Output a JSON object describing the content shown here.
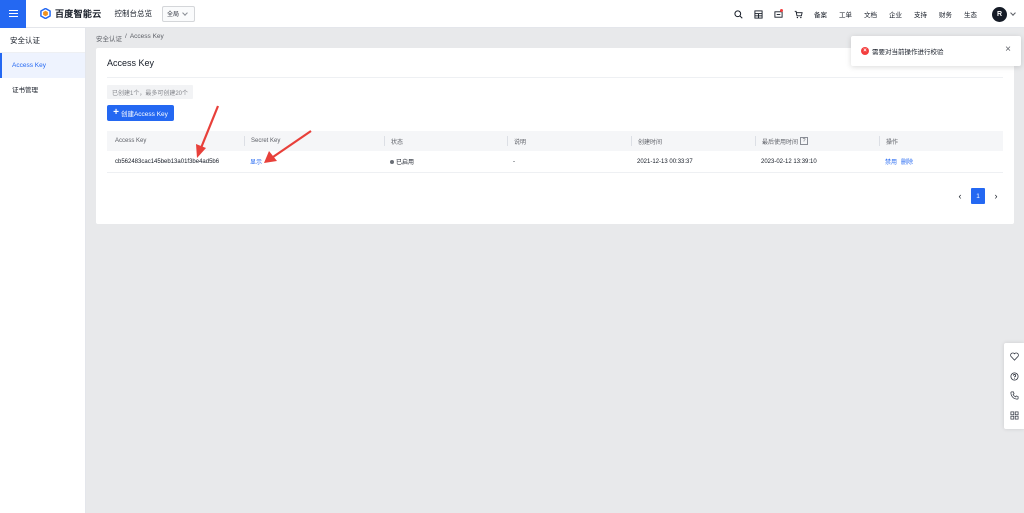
{
  "header": {
    "logo_text": "百度智能云",
    "console_label": "控制台总览",
    "region_label": "全局",
    "nav": [
      "备案",
      "工单",
      "文档",
      "企业",
      "支持",
      "财务",
      "生态"
    ],
    "avatar_initial": "R",
    "icons": [
      "search-icon",
      "grid-icon",
      "message-icon",
      "cart-icon"
    ]
  },
  "sidebar": {
    "title": "安全认证",
    "items": [
      {
        "label": "Access Key",
        "active": true
      },
      {
        "label": "证书管理",
        "active": false
      }
    ]
  },
  "breadcrumb": {
    "parent": "安全认证",
    "separator": "/",
    "current": "Access Key"
  },
  "card": {
    "title": "Access Key",
    "quota_text": "已创建1个，最多可创建20个",
    "create_button": "创建Access Key"
  },
  "table": {
    "columns": [
      "Access Key",
      "Secret Key",
      "状态",
      "说明",
      "创建时间",
      "最后使用时间",
      "操作"
    ],
    "help_mark": "?",
    "rows": [
      {
        "access_key": "cb562483cac145beb13a01f3be4ad5b6",
        "secret_key_action": "显示",
        "status": "已启用",
        "description": "-",
        "created": "2021-12-13 00:33:37",
        "last_used": "2023-02-12 13:39:10",
        "actions": [
          "禁用",
          "删除"
        ]
      }
    ]
  },
  "pagination": {
    "current_page": "1"
  },
  "toast": {
    "message": "需要对当前操作进行校验"
  },
  "colors": {
    "primary": "#2468f2",
    "error": "#f33e3e",
    "annotation_arrow": "#e8403a"
  }
}
